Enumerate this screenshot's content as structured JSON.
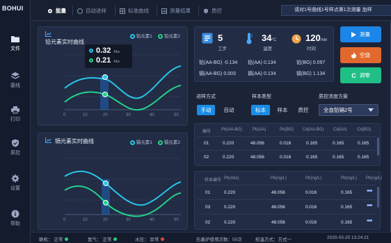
{
  "app": {
    "logo": "BOHUI"
  },
  "sidebar": {
    "items": [
      {
        "label": "文件",
        "icon": "folder-icon"
      },
      {
        "label": "基线",
        "icon": "layers-icon"
      },
      {
        "label": "打印",
        "icon": "printer-icon"
      },
      {
        "label": "质控",
        "icon": "shield-icon"
      },
      {
        "label": "设置",
        "icon": "gear-icon"
      },
      {
        "label": "帮助",
        "icon": "info-icon"
      }
    ]
  },
  "tabs": [
    {
      "label": "能量",
      "active": true
    },
    {
      "label": "自动进样",
      "active": false
    },
    {
      "label": "标准曲线",
      "active": false
    },
    {
      "label": "测量结果",
      "active": false
    },
    {
      "label": "质控",
      "active": false
    }
  ],
  "notice": "请对1号曲线1号样点第1次测量 加样",
  "chart1": {
    "title": "铅元素实时曲线",
    "legend": [
      "铅元素1",
      "铅元素2"
    ],
    "tooltip": {
      "value1": "0.32",
      "value2": "0.21",
      "unit": "Abs"
    },
    "xticks": [
      "0",
      "10",
      "20",
      "30",
      "40",
      "50"
    ]
  },
  "chart2": {
    "title": "镉元素实时曲线",
    "legend": [
      "镉元素1",
      "镉元素2"
    ],
    "xticks": [
      "0",
      "10",
      "20",
      "30",
      "40",
      "50"
    ]
  },
  "stats": {
    "station": {
      "value": "5",
      "label": "工步"
    },
    "temp": {
      "value": "34",
      "unit": "°C",
      "label": "温度"
    },
    "time": {
      "value": "120",
      "unit": "min",
      "label": "时间"
    },
    "readings": [
      {
        "label": "铅(AA-BG)",
        "value": "-0.134"
      },
      {
        "label": "铅(AA)",
        "value": "0.134"
      },
      {
        "label": "铅(BG)",
        "value": "0.097"
      },
      {
        "label": "镉(AA-BG)",
        "value": "0.003"
      },
      {
        "label": "镉(AA)",
        "value": "0.134"
      },
      {
        "label": "镉(BG)",
        "value": "1.134"
      }
    ]
  },
  "actions": {
    "measure": "测量",
    "blank": "空烧",
    "zero": "调零",
    "colors": {
      "measure": "#1c86e8",
      "blank": "#e2692e",
      "zero": "#1fbf86"
    }
  },
  "controls": {
    "mode_label": "进样方式",
    "mode_options": [
      "手动",
      "自动"
    ],
    "sample_type_label": "样本类型",
    "sample_type_options": [
      "标本",
      "样本",
      "质控"
    ],
    "qc_label": "质控浓度方案",
    "qc_selected": "全血铅镉2号"
  },
  "table1": {
    "headers": [
      "编号",
      "Pb(AA-BG)",
      "Pb(AA)",
      "Pb(BG)",
      "Cd(AA-BG)",
      "Cd(AA)",
      "Cd(BG)"
    ],
    "rows": [
      [
        "01",
        "0.220",
        "48.056",
        "0.016",
        "0.165",
        "0.165",
        "0.165"
      ],
      [
        "02",
        "0.220",
        "48.056",
        "0.016",
        "0.165",
        "0.165",
        "0.165"
      ]
    ]
  },
  "table2": {
    "headers": [
      "样本编号",
      "Pb(Abs)",
      "Pb(ng/L)",
      "Pb(ng/L)",
      "Pb(ng/L)",
      "Pb(ng/L)"
    ],
    "rows": [
      [
        "01",
        "0.220",
        "48.056",
        "0.016",
        "0.165"
      ],
      [
        "03",
        "0.220",
        "48.056",
        "0.016",
        "0.165"
      ],
      [
        "02",
        "0.220",
        "48.056",
        "0.016",
        "0.165"
      ]
    ]
  },
  "statusbar": {
    "items": [
      {
        "label": "联机：",
        "value": "正常",
        "color": "#2bd07a"
      },
      {
        "label": "氩气：",
        "value": "正常",
        "color": "#2bd07a"
      },
      {
        "label": "水压：",
        "value": "异常",
        "color": "#e84545"
      }
    ],
    "lamp": "石墨炉使用次数：50次",
    "calib": "校温方式：方式一",
    "datetime": "2020-03-25 13:24:21"
  }
}
